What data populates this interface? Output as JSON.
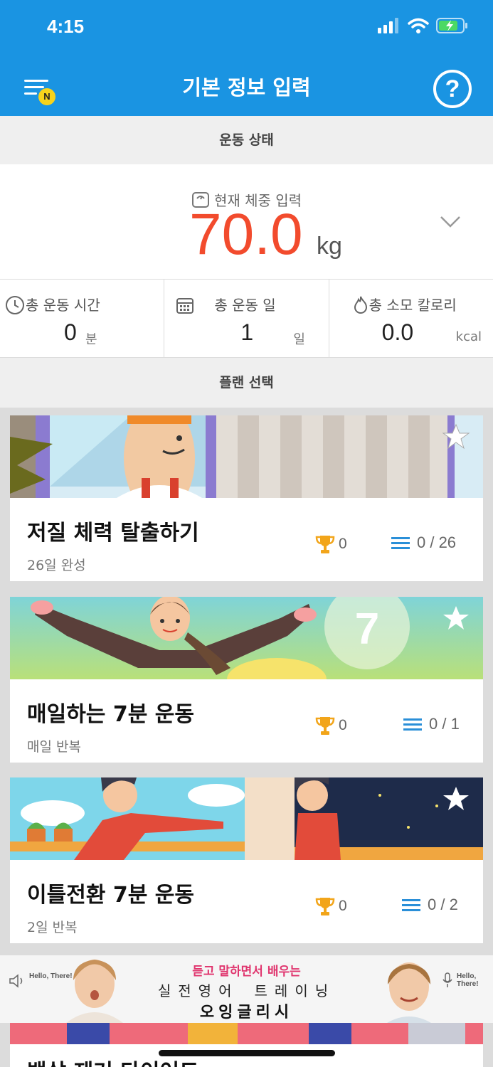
{
  "status_bar": {
    "time": "4:15"
  },
  "header": {
    "title": "기본 정보 입력",
    "menu_badge": "N",
    "help_label": "?"
  },
  "exercise_status": {
    "section_title": "운동 상태",
    "weight_label": "현재 체중 입력",
    "weight_value": "70.0",
    "weight_unit": "kg"
  },
  "stats": [
    {
      "label": "총 운동 시간",
      "value": "0",
      "unit": "분"
    },
    {
      "label": "총 운동 일",
      "value": "1",
      "unit": "일"
    },
    {
      "label": "총 소모 칼로리",
      "value": "0.0",
      "unit": "kcal"
    }
  ],
  "plans": {
    "section_title": "플랜 선택",
    "items": [
      {
        "title": "저질 체력 탈출하기",
        "subtitle": "26일 완성",
        "trophies": "0",
        "progress": "0 / 26"
      },
      {
        "title": "매일하는 7분 운동",
        "subtitle": "매일 반복",
        "trophies": "0",
        "progress": "0 / 1"
      },
      {
        "title": "이틀전환 7분 운동",
        "subtitle": "2일 반복",
        "trophies": "0",
        "progress": "0 / 2"
      }
    ],
    "next_title": "뱃살 제거 다이어트"
  },
  "ad": {
    "line1": "듣고 말하면서 배우는",
    "line2": "실전영어 트레이닝",
    "line3": "오잉글리시",
    "hello": "Hello, There!"
  },
  "colors": {
    "brand": "#1a94e2",
    "weight": "#f24b2d",
    "progress_icon": "#2a8fd8",
    "trophy": "#f2a51a"
  }
}
